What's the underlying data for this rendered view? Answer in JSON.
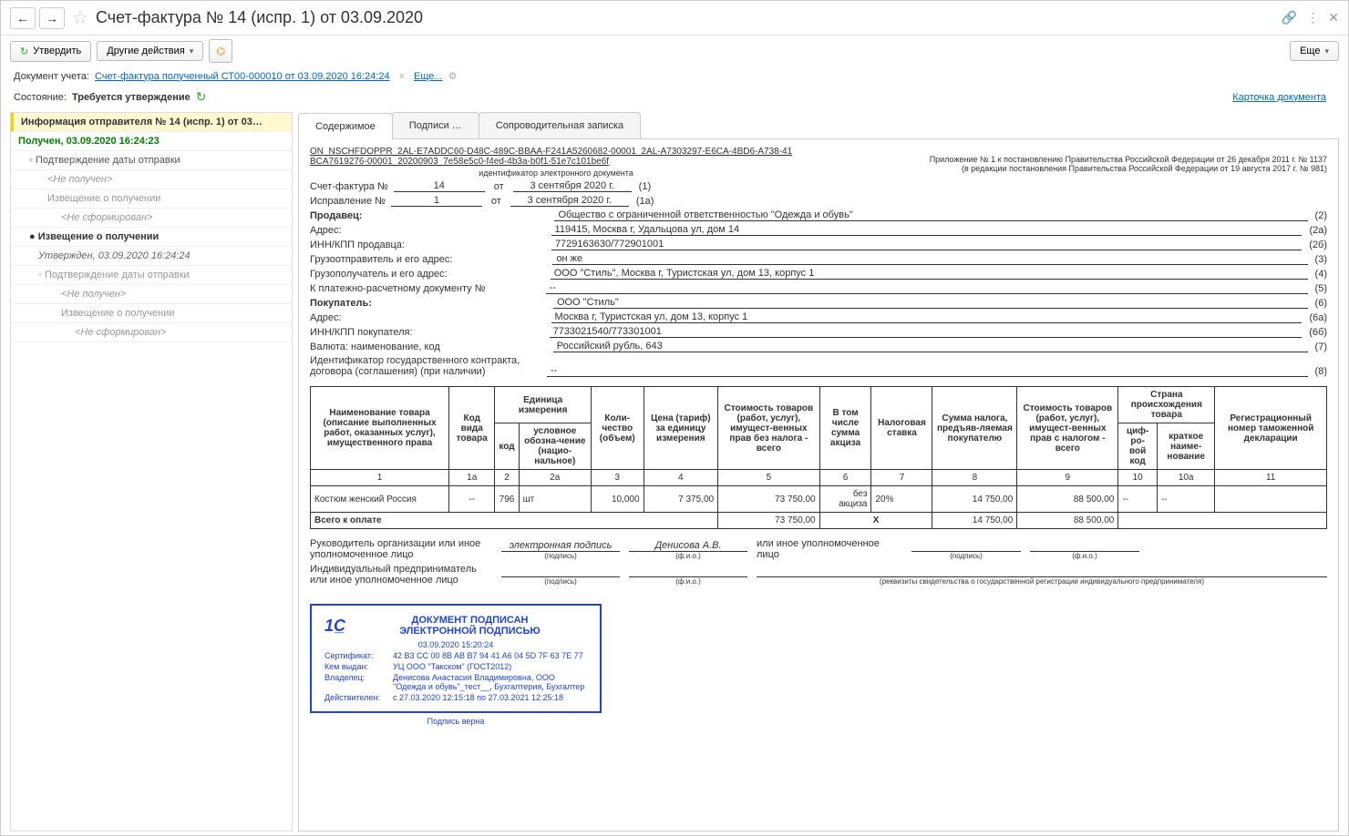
{
  "title": "Счет-фактура № 14 (испр. 1) от 03.09.2020",
  "toolbar": {
    "approve": "Утвердить",
    "other_actions": "Другие действия",
    "more": "Еще"
  },
  "docline": {
    "label": "Документ учета:",
    "link": "Счет-фактура полученный СТ00-000010 от 03.09.2020 16:24:24",
    "more": "Еще..."
  },
  "stateline": {
    "label": "Состояние:",
    "value": "Требуется утверждение",
    "card_link": "Карточка документа"
  },
  "tree": {
    "t0": "Информация отправителя № 14 (испр. 1) от 03…",
    "t1": "Получен, 03.09.2020 16:24:23",
    "t2": "Подтверждение даты отправки",
    "t3": "<Не получен>",
    "t4": "Извещение о получении",
    "t5": "<Не сформирован>",
    "t6": "Извещение о получении",
    "t7": "Утвержден, 03.09.2020 16:24:24",
    "t8": "Подтверждение даты отправки",
    "t9": "<Не получен>",
    "t10": "Извещение о получении",
    "t11": "<Не сформирован>"
  },
  "tabs": {
    "content": "Содержимое",
    "sigs": "Подписи …",
    "note": "Сопроводительная записка"
  },
  "doc": {
    "id1": "ON_NSCHFDOPPR_2AL-E7ADDC60-D48C-489C-BBAA-F241A5260682-00001_2AL-A7303297-E6CA-4BD6-A738-41",
    "id2": "BCA7619276-00001_20200903_7e58e5c0-f4ed-4b3a-b0f1-51e7c101be6f",
    "id_label": "идентификатор электронного документа",
    "appendix1": "Приложение № 1 к постановлению Правительства Российской Федерации от 26 декабря 2011 г. № 1137",
    "appendix2": "(в редакции постановления Правительства Российской Федерации от 19 августа 2017 г. № 981)",
    "f": {
      "sf_label": "Счет-фактура №",
      "sf_no": "14",
      "from": "от",
      "sf_date": "3 сентября 2020 г.",
      "sf_ref": "(1)",
      "isp_label": "Исправление №",
      "isp_no": "1",
      "isp_date": "3 сентября 2020 г.",
      "isp_ref": "(1a)",
      "seller_label": "Продавец:",
      "seller": "Общество с ограниченной ответственностью \"Одежда и обувь\"",
      "seller_ref": "(2)",
      "addr_label": "Адрес:",
      "seller_addr": "119415, Москва г, Удальцова ул, дом 14",
      "seller_addr_ref": "(2а)",
      "innkpp_s_label": "ИНН/КПП продавца:",
      "innkpp_s": "7729163630/772901001",
      "innkpp_s_ref": "(2б)",
      "shipper_label": "Грузоотправитель и его адрес:",
      "shipper": "он же",
      "shipper_ref": "(3)",
      "consignee_label": "Грузополучатель и его адрес:",
      "consignee": "ООО \"Стиль\", Москва г, Туристская ул, дом 13, корпус 1",
      "consignee_ref": "(4)",
      "paydoc_label": "К платежно-расчетному документу №",
      "paydoc": "--",
      "paydoc_ref": "(5)",
      "buyer_label": "Покупатель:",
      "buyer": "ООО \"Стиль\"",
      "buyer_ref": "(6)",
      "buyer_addr": "Москва г, Туристская ул, дом 13, корпус 1",
      "buyer_addr_ref": "(6а)",
      "innkpp_b_label": "ИНН/КПП покупателя:",
      "innkpp_b": "7733021540/773301001",
      "innkpp_b_ref": "(6б)",
      "currency_label": "Валюта: наименование, код",
      "currency": "Российский рубль, 643",
      "currency_ref": "(7)",
      "contract_label1": "Идентификатор государственного контракта,",
      "contract_label2": "договора (соглашения) (при наличии)",
      "contract": "--",
      "contract_ref": "(8)"
    },
    "th": {
      "name": "Наименование товара (описание выполненных работ, оказанных услуг), имущественного права",
      "code": "Код вида товара",
      "unit": "Единица измерения",
      "unit_code": "код",
      "unit_sym": "условное обозна-чение (нацио-нальное)",
      "qty": "Коли-чество (объем)",
      "price": "Цена (тариф) за единицу измерения",
      "cost_novat": "Стоимость товаров (работ, услуг), имущест-венных прав без налога - всего",
      "excise": "В том числе сумма акциза",
      "rate": "Налоговая ставка",
      "tax": "Сумма налога, предъяв-ляемая покупателю",
      "cost_vat": "Стоимость товаров (работ, услуг), имущест-венных прав с налогом - всего",
      "country": "Страна происхождения товара",
      "country_code": "циф-ро-вой код",
      "country_name": "краткое наиме-нование",
      "decl": "Регистрационный номер таможенной декларации",
      "n1": "1",
      "n1a": "1а",
      "n2": "2",
      "n2a": "2а",
      "n3": "3",
      "n4": "4",
      "n5": "5",
      "n6": "6",
      "n7": "7",
      "n8": "8",
      "n9": "9",
      "n10": "10",
      "n10a": "10а",
      "n11": "11"
    },
    "row": {
      "name": "Костюм женский Россия",
      "code": "--",
      "ucode": "796",
      "usym": "шт",
      "qty": "10,000",
      "price": "7 375,00",
      "cost_novat": "73 750,00",
      "excise": "без акциза",
      "rate": "20%",
      "tax": "14 750,00",
      "cost_vat": "88 500,00",
      "ccode": "--",
      "cname": "--",
      "decl": ""
    },
    "total": {
      "label": "Всего к оплате",
      "cost_novat": "73 750,00",
      "excise_x": "X",
      "tax": "14 750,00",
      "cost_vat": "88 500,00"
    },
    "sig": {
      "head_label": "Руководитель организации или иное уполномоченное лицо",
      "esig": "электронная подпись",
      "head_name": "Денисова А.В.",
      "other_label": "или иное уполномоченное лицо",
      "ip_label": "Индивидуальный предприниматель или иное уполномоченное лицо",
      "sub_sign": "(подпись)",
      "sub_fio": "(ф.и.о.)",
      "sub_req": "(реквизиты свидетельства о государственной  регистрации индивидуального предпринимателя)"
    }
  },
  "stamp": {
    "title1": "ДОКУМЕНТ ПОДПИСАН",
    "title2": "ЭЛЕКТРОННОЙ ПОДПИСЬЮ",
    "date": "03.09.2020 15:20:24",
    "cert_k": "Сертификат:",
    "cert_v": "42 B3 CC 00 8B AB B7 94 41 A6 04 5D 7F 63 7E 77",
    "issuer_k": "Кем выдан:",
    "issuer_v": "УЦ ООО \"Такском\" (ГОСТ2012)",
    "owner_k": "Владелец:",
    "owner_v": "Денисова Анастасия Владимировна, ООО \"Одежда и обувь\"_тест__, Бухгалтерия, Бухгалтер",
    "valid_k": "Действителен:",
    "valid_v": "с 27.03.2020 12:15:18 по 27.03.2021 12:25:18",
    "ok": "Подпись верна"
  }
}
